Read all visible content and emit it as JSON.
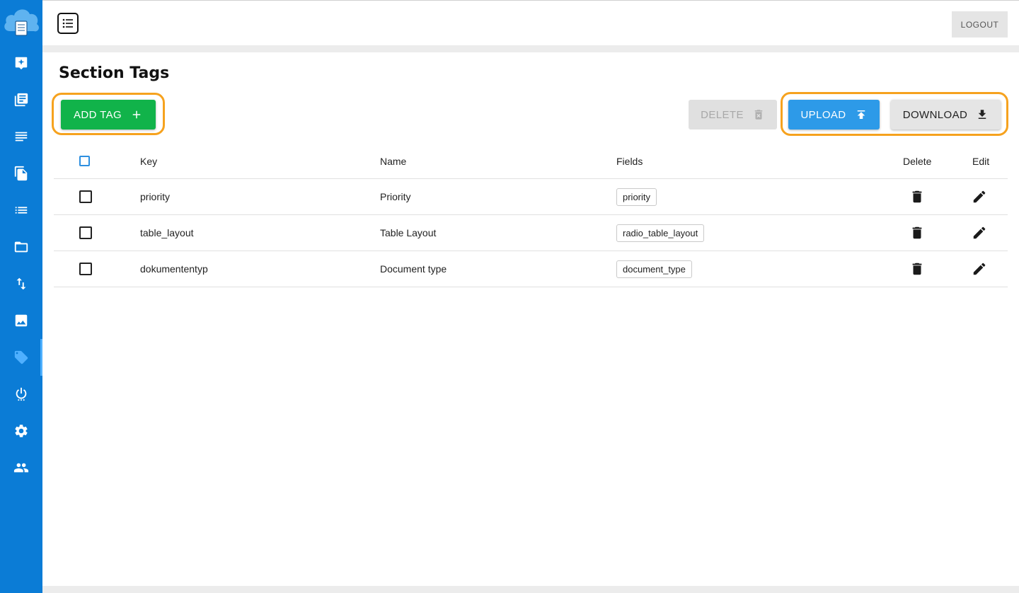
{
  "page": {
    "title": "Section Tags"
  },
  "topbar": {
    "logout_label": "LOGOUT"
  },
  "sidebar": {
    "items": [
      {
        "icon": "star-badge-icon"
      },
      {
        "icon": "library-icon"
      },
      {
        "icon": "text-lines-icon"
      },
      {
        "icon": "file-copy-icon"
      },
      {
        "icon": "list-icon"
      },
      {
        "icon": "folder-icon"
      },
      {
        "icon": "swap-vertical-icon"
      },
      {
        "icon": "image-icon"
      },
      {
        "icon": "tag-icon",
        "active": true
      },
      {
        "icon": "power-icon"
      },
      {
        "icon": "gear-icon"
      },
      {
        "icon": "users-icon"
      }
    ]
  },
  "toolbar": {
    "add_label": "ADD TAG",
    "delete_label": "DELETE",
    "upload_label": "UPLOAD",
    "download_label": "DOWNLOAD"
  },
  "table": {
    "headers": {
      "key": "Key",
      "name": "Name",
      "fields": "Fields",
      "delete": "Delete",
      "edit": "Edit"
    },
    "rows": [
      {
        "key": "priority",
        "name": "Priority",
        "field": "priority"
      },
      {
        "key": "table_layout",
        "name": "Table Layout",
        "field": "radio_table_layout"
      },
      {
        "key": "dokumententyp",
        "name": "Document type",
        "field": "document_type"
      }
    ]
  },
  "colors": {
    "sidebar": "#0b7cd6",
    "add_button": "#11b34a",
    "upload_button": "#2d9ae8",
    "highlight": "#f6a21e"
  }
}
